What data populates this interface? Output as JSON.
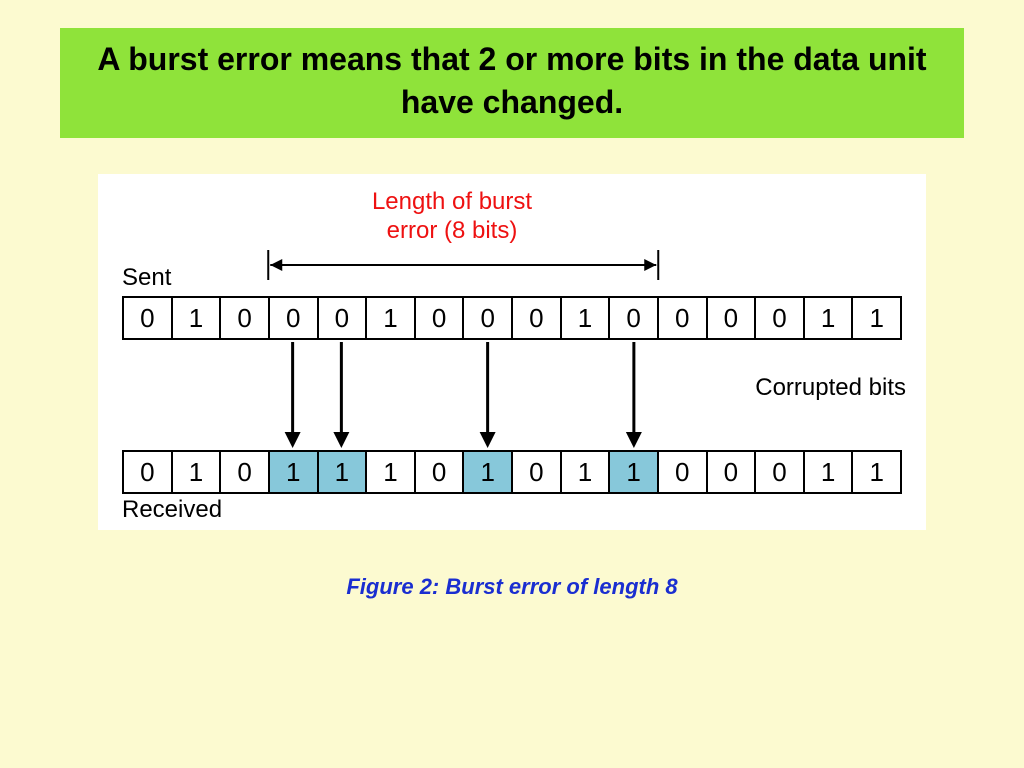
{
  "title": "A burst error means that 2 or more bits in the data unit have changed.",
  "diagram": {
    "burst_label_line1": "Length of burst",
    "burst_label_line2": "error (8 bits)",
    "sent_label": "Sent",
    "received_label": "Received",
    "corrupted_label": "Corrupted bits",
    "sent_bits": [
      "0",
      "1",
      "0",
      "0",
      "0",
      "1",
      "0",
      "0",
      "0",
      "1",
      "0",
      "0",
      "0",
      "0",
      "1",
      "1"
    ],
    "received_bits": [
      "0",
      "1",
      "0",
      "1",
      "1",
      "1",
      "0",
      "1",
      "0",
      "1",
      "1",
      "0",
      "0",
      "0",
      "1",
      "1"
    ],
    "corrupted_indices": [
      3,
      4,
      7,
      10
    ],
    "burst_span": {
      "start_index": 3,
      "end_index": 10
    },
    "burst_length": 8
  },
  "caption": "Figure 2: Burst error of length 8"
}
